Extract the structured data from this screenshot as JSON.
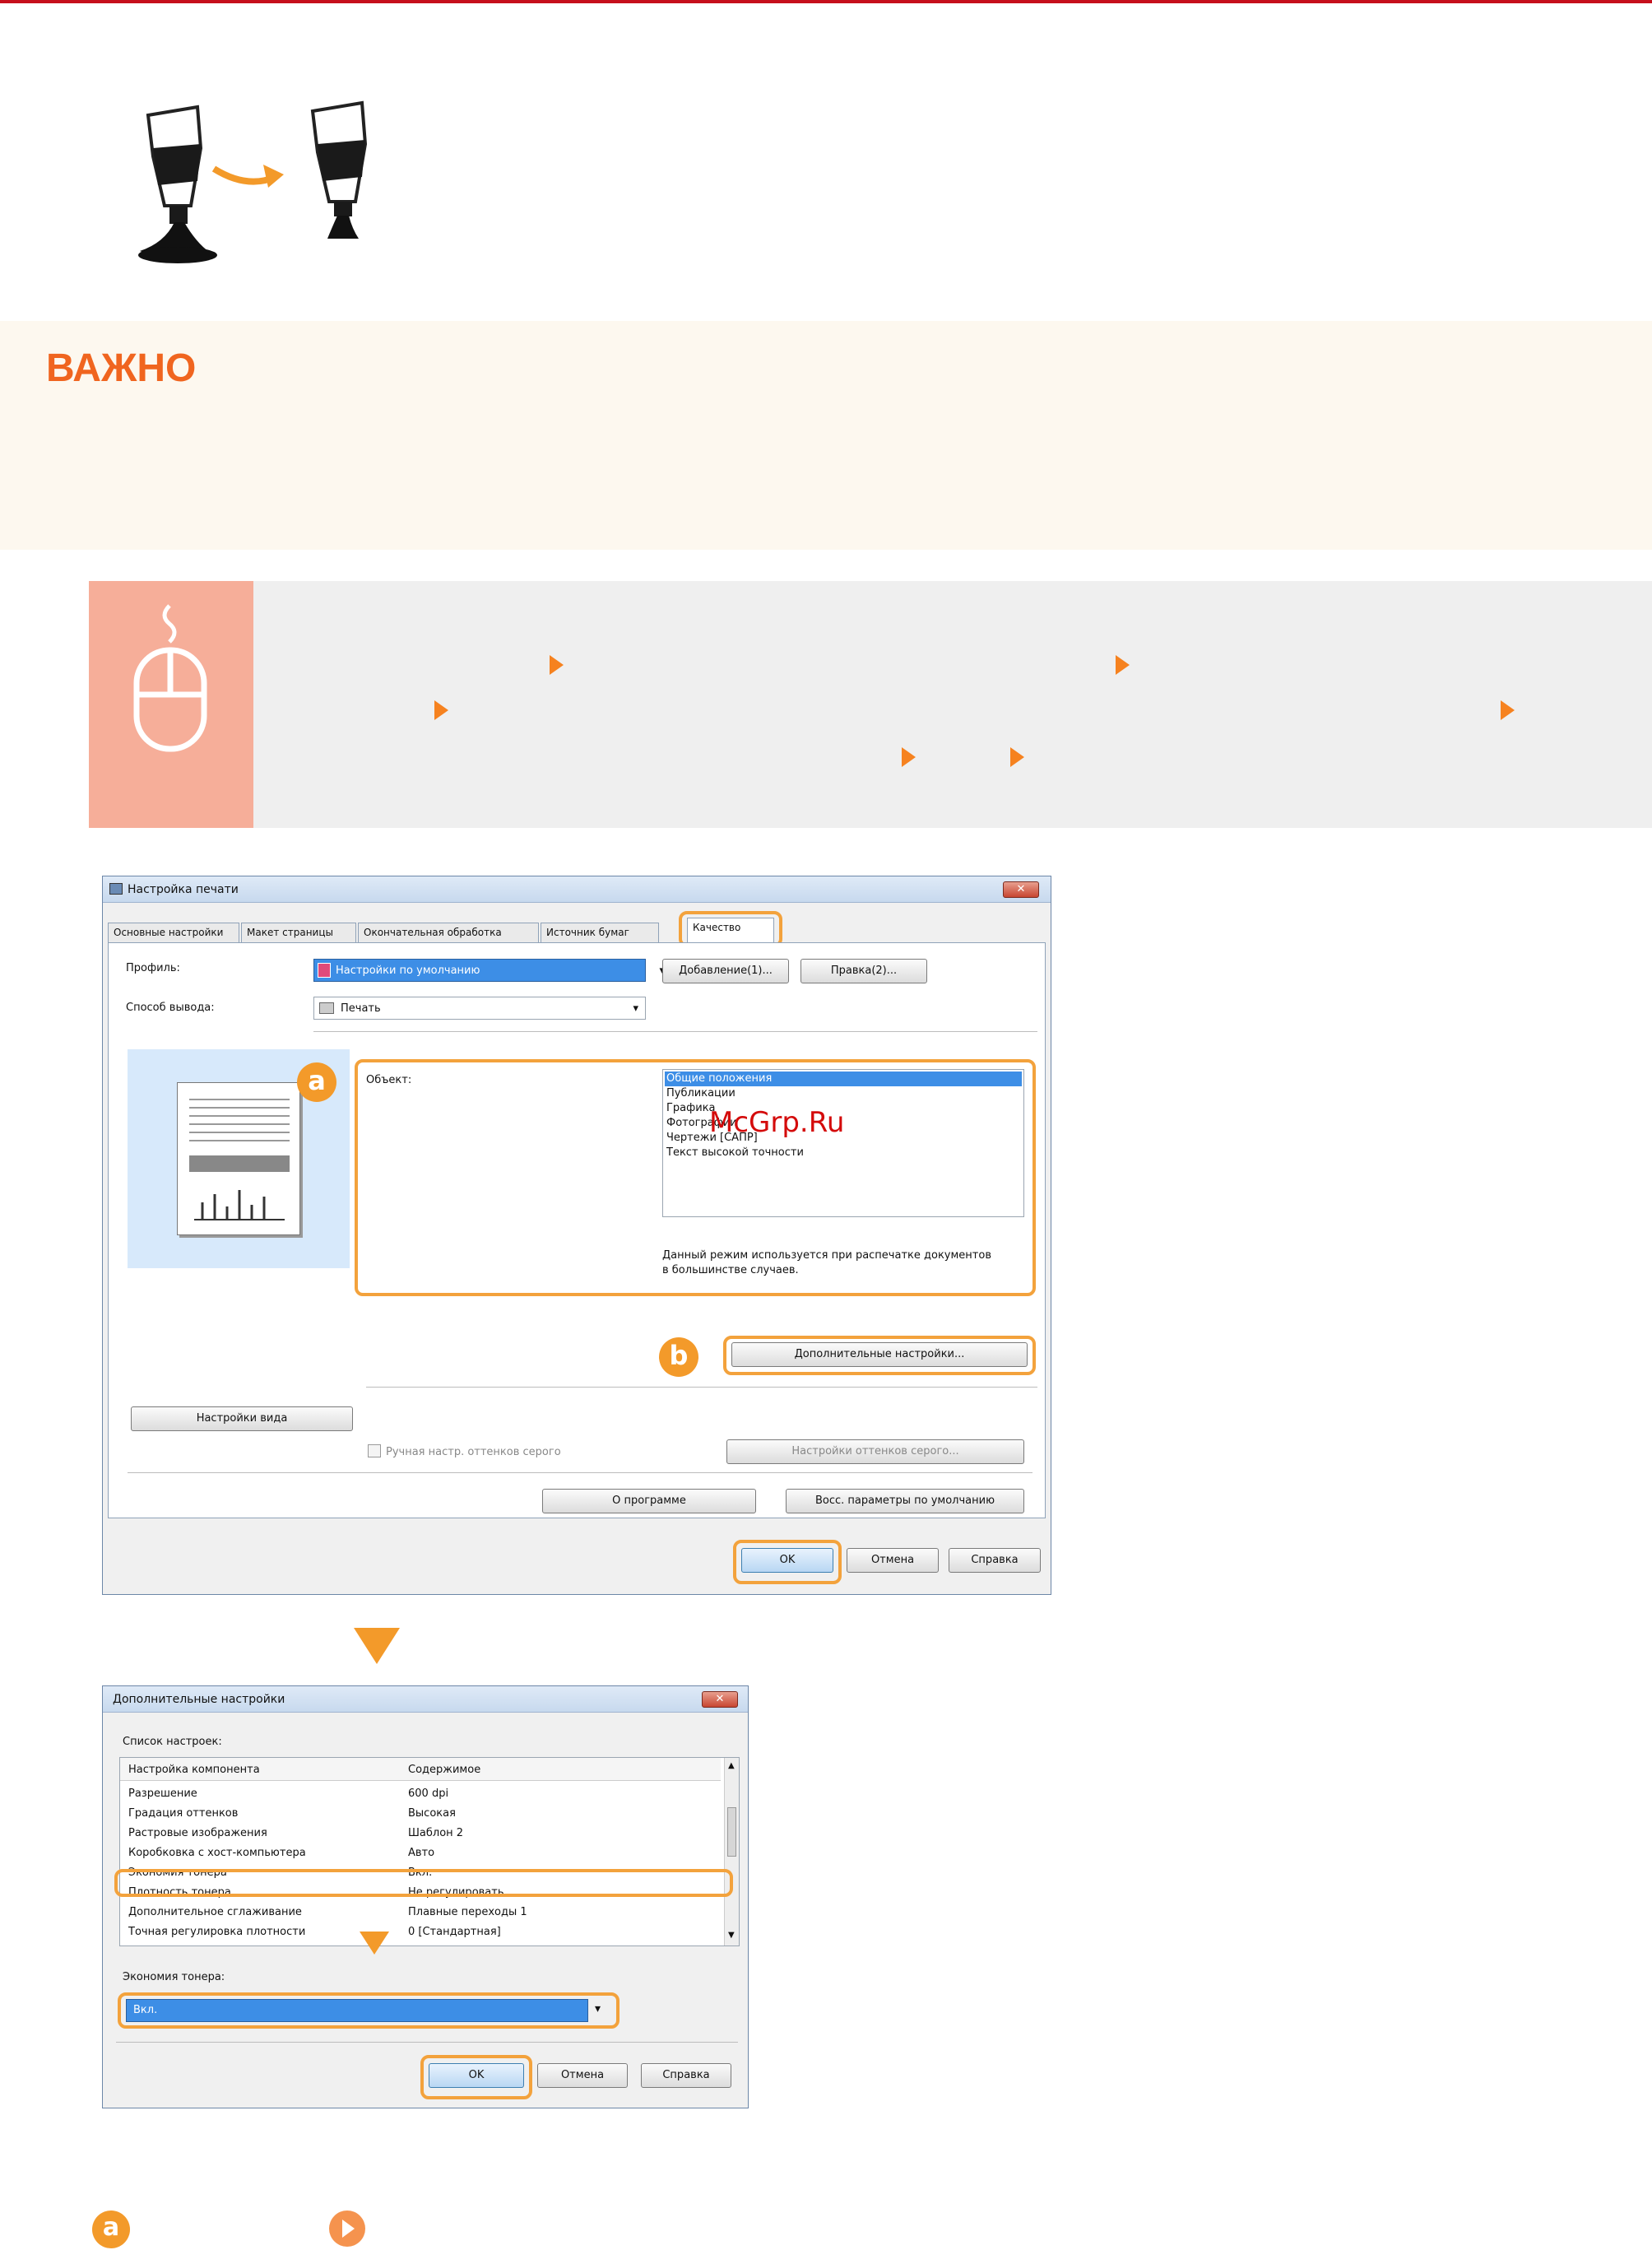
{
  "important": {
    "title": "ВАЖНО"
  },
  "watermark": "McGrp.Ru",
  "dialog1": {
    "title": "Настройка печати",
    "close": "✕",
    "tabs": [
      "Основные настройки",
      "Макет страницы",
      "Окончательная обработка",
      "Источник бумаг",
      "Качество"
    ],
    "profile_label": "Профиль:",
    "profile_value": "Настройки по умолчанию",
    "add_btn": "Добавление(1)...",
    "edit_btn": "Правка(2)...",
    "output_label": "Способ вывода:",
    "output_value": "Печать",
    "object_label": "Объект:",
    "objects": [
      "Общие положения",
      "Публикации",
      "Графика",
      "Фотографии",
      "Чертежи [САПР]",
      "Текст высокой точности"
    ],
    "desc": "Данный режим используется при распечатке документов в большинстве случаев.",
    "advanced_btn": "Дополнительные настройки...",
    "view_btn": "Настройки вида",
    "gray_check": "Ручная настр. оттенков серого",
    "gray_btn": "Настройки оттенков серого...",
    "about_btn": "О программе",
    "restore_btn": "Восс. параметры по умолчанию",
    "ok": "OK",
    "cancel": "Отмена",
    "help": "Справка",
    "badge_a": "a",
    "badge_b": "b"
  },
  "dialog2": {
    "title": "Дополнительные настройки",
    "close": "✕",
    "list_label": "Список настроек:",
    "col1": "Настройка компонента",
    "col2": "Содержимое",
    "rows": [
      {
        "k": "Разрешение",
        "v": "600 dpi"
      },
      {
        "k": "Градация оттенков",
        "v": "Высокая"
      },
      {
        "k": "Растровые изображения",
        "v": "Шаблон 2"
      },
      {
        "k": "Коробковка с хост-компьютера",
        "v": "Авто"
      },
      {
        "k": "Экономия тонера",
        "v": "Вкл."
      },
      {
        "k": "Плотность тонера",
        "v": "Не регулировать"
      },
      {
        "k": "Дополнительное сглаживание",
        "v": "Плавные переходы 1"
      },
      {
        "k": "Точная регулировка плотности",
        "v": "0 [Стандартная]"
      }
    ],
    "toner_label": "Экономия тонера:",
    "toner_value": "Вкл.",
    "ok": "OK",
    "cancel": "Отмена",
    "help": "Справка"
  },
  "footer": {
    "badge": "a"
  }
}
